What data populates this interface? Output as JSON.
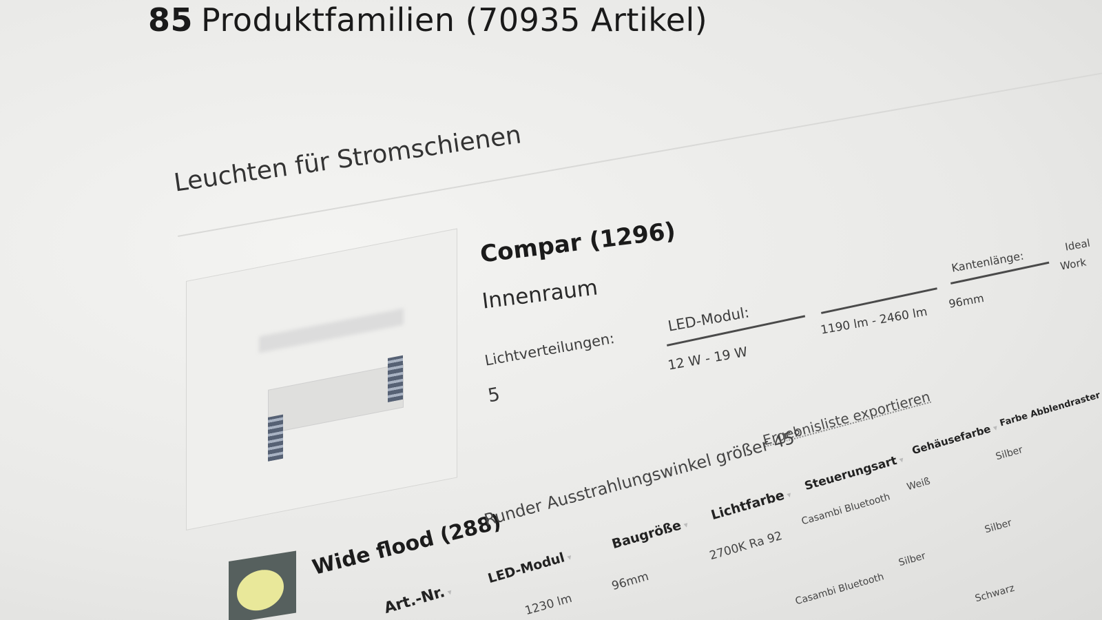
{
  "results": {
    "count": "85",
    "summary": "Produktfamilien (70935 Artikel)"
  },
  "category": {
    "title": "Leuchten für Stromschienen"
  },
  "family": {
    "title": "Compar (1296)",
    "subtitle": "Innenraum",
    "distribution_label": "Lichtverteilungen:",
    "distribution_value": "5",
    "properties": [
      {
        "label": "LED-Modul:",
        "value": "12 W - 19 W"
      },
      {
        "label": "",
        "value": "1190 lm - 2460 lm"
      },
      {
        "label": "Kantenlänge:",
        "value": "96mm"
      },
      {
        "label": "Ideal",
        "value": "Work"
      }
    ]
  },
  "variant": {
    "title": "Wide flood (288)",
    "description": "Runder Ausstrahlungswinkel größer 45°",
    "export_label": "Ergebnisliste exportieren",
    "swatch_color": "#e9e89a"
  },
  "table": {
    "headers": [
      "Art.-Nr.",
      "LED-Modul",
      "Baugröße",
      "Lichtfarbe",
      "Steuerungsart",
      "Gehäusefarbe",
      "Farbe Abblendraster"
    ],
    "rows": [
      [
        "",
        "1230 lm",
        "96mm",
        "2700K Ra 92",
        "Casambi Bluetooth",
        "Weiß",
        "Silber"
      ],
      [
        "",
        "",
        "",
        "",
        "Casambi Bluetooth",
        "Silber",
        "Silber"
      ],
      [
        "",
        "",
        "",
        "",
        "",
        "",
        "Schwarz"
      ]
    ]
  }
}
